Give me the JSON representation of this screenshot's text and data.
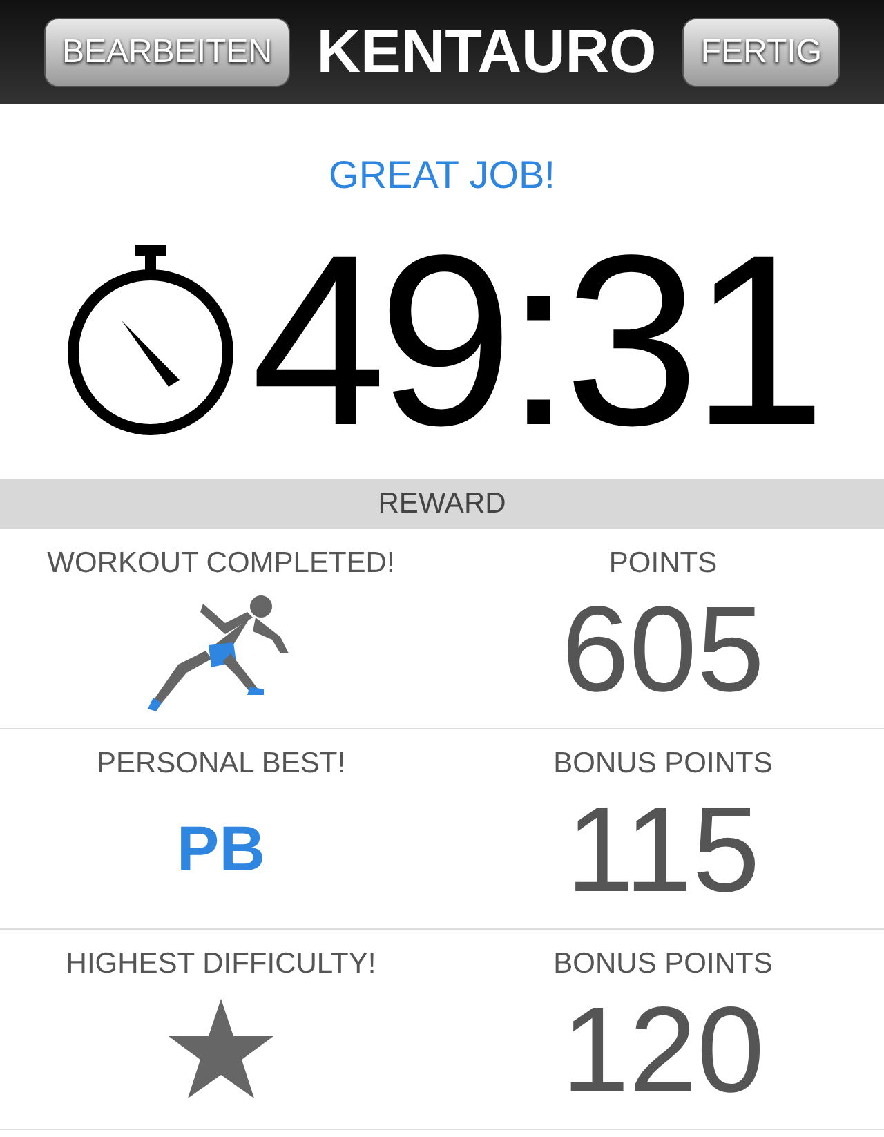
{
  "header": {
    "left_button": "BEARBEITEN",
    "title": "KENTAURO",
    "right_button": "FERTIG"
  },
  "message": "GREAT JOB!",
  "time": "49:31",
  "section_title": "REWARD",
  "rewards": [
    {
      "kind": "runner",
      "label": "WORKOUT COMPLETED!",
      "points_label": "POINTS",
      "points": "605"
    },
    {
      "kind": "badge",
      "label": "PERSONAL BEST!",
      "badge": "PB",
      "points_label": "BONUS POINTS",
      "points": "115"
    },
    {
      "kind": "star",
      "label": "HIGHEST DIFFICULTY!",
      "points_label": "BONUS POINTS",
      "points": "120"
    }
  ]
}
